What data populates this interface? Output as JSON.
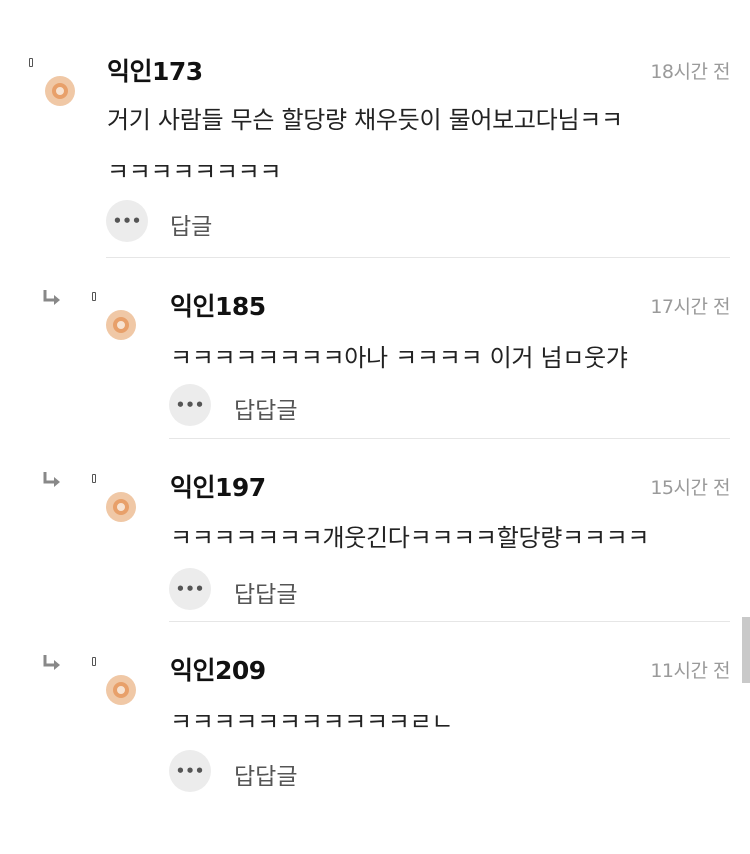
{
  "comments": [
    {
      "author": "익인173",
      "time": "18시간 전",
      "lines": [
        "거기 사람들 무슨 할당량 채우듯이 물어보고다님ㅋㅋ",
        "ㅋㅋㅋㅋㅋㅋㅋㅋ"
      ],
      "reply_label": "답글"
    },
    {
      "author": "익인185",
      "time": "17시간 전",
      "lines": [
        "ㅋㅋㅋㅋㅋㅋㅋㅋ아나 ㅋㅋㅋㅋ 이거 넘ㅁ웃갸"
      ],
      "reply_label": "답답글"
    },
    {
      "author": "익인197",
      "time": "15시간 전",
      "lines": [
        "ㅋㅋㅋㅋㅋㅋㅋ개웃긴다ㅋㅋㅋㅋ할당량ㅋㅋㅋㅋ"
      ],
      "reply_label": "답답글"
    },
    {
      "author": "익인209",
      "time": "11시간 전",
      "lines": [
        "ㅋㅋㅋㅋㅋㅋㅋㅋㅋㅋㅋㄹㄴ"
      ],
      "reply_label": "답답글"
    }
  ],
  "more_button_glyph": "•••",
  "colors": {
    "avatar_outer": "#f0c8a6",
    "avatar_ring": "#e8a06a",
    "time": "#9a9a9a",
    "divider": "#e6e6e6"
  },
  "icons": {
    "reply_arrow": "reply-arrow-icon",
    "more": "more-dots-icon"
  }
}
